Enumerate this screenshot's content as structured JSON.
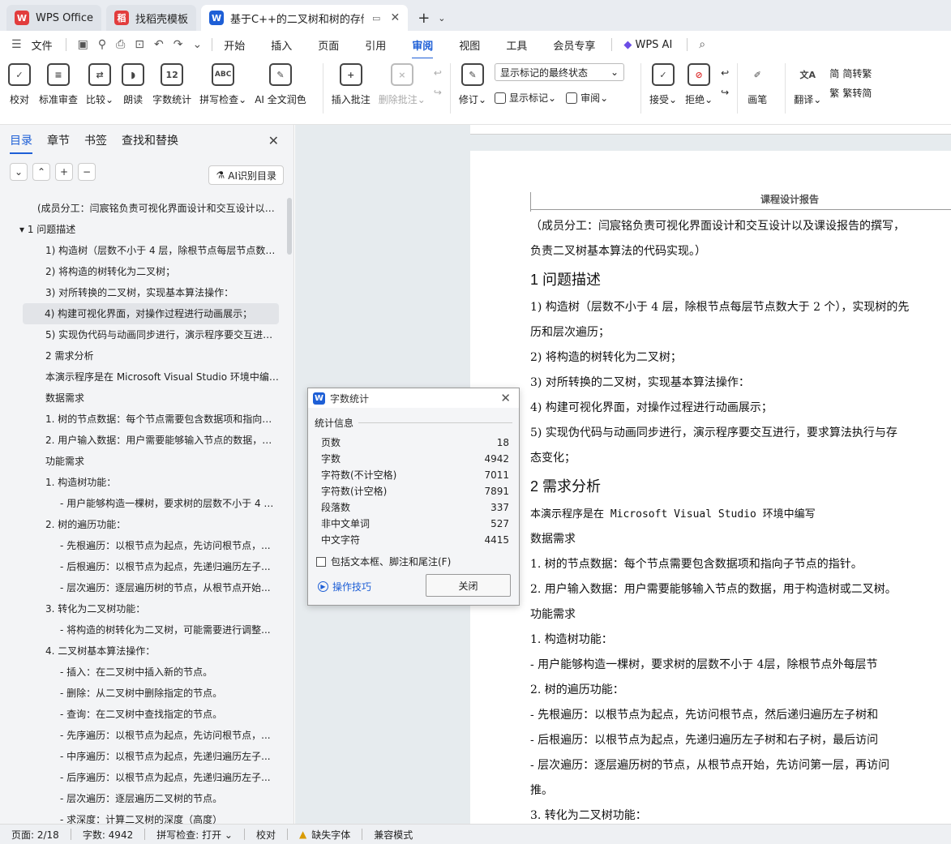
{
  "tabs": [
    {
      "label": "WPS Office",
      "icon": "W",
      "color": "#e23d3d"
    },
    {
      "label": "找稻壳模板",
      "icon": "稻",
      "color": "#e23d3d"
    },
    {
      "label": "基于C++的二叉树和树的存储",
      "icon": "W",
      "color": "#1e5fd6"
    }
  ],
  "menu": {
    "file": "文件",
    "items": [
      "开始",
      "插入",
      "页面",
      "引用",
      "审阅",
      "视图",
      "工具",
      "会员专享"
    ],
    "active": "审阅",
    "wpsai": "WPS AI"
  },
  "ribbon": {
    "proof": "校对",
    "std_review": "标准审查",
    "compare": "比较",
    "read": "朗读",
    "wordcount": "字数统计",
    "spell": "拼写检查",
    "ai_polish": "AI 全文润色",
    "insert_comment": "插入批注",
    "delete_comment": "删除批注",
    "track": "修订",
    "show_markup_combo": "显示标记的最终状态",
    "show_markup": "显示标记",
    "review": "审阅",
    "accept": "接受",
    "reject": "拒绝",
    "pen": "画笔",
    "translate": "翻译",
    "to_trad": "简转繁",
    "to_simp": "繁转简"
  },
  "nav": {
    "tabs": [
      "目录",
      "章节",
      "书签",
      "查找和替换"
    ],
    "active_tab": "目录",
    "ai_button": "AI识别目录",
    "items": [
      {
        "text": "(成员分工：闫宸铭负责可视化界面设计和交互设计以及课设报告的撰写...",
        "indent": 46
      },
      {
        "text": "▾  1  问题描述",
        "indent": 24
      },
      {
        "text": "1) 构造树（层数不小于 4 层，除根节点每层节点数大于 2 个）...",
        "indent": 56
      },
      {
        "text": "2) 将构造的树转化为二叉树；",
        "indent": 56
      },
      {
        "text": "3) 对所转换的二叉树，实现基本算法操作：",
        "indent": 56
      },
      {
        "text": "4) 构建可视化界面，对操作过程进行动画展示；",
        "indent": 56,
        "selected": true
      },
      {
        "text": "5) 实现伪代码与动画同步进行，演示程序要交互进行...",
        "indent": 56
      },
      {
        "text": "2  需求分析",
        "indent": 56
      },
      {
        "text": "本演示程序是在 Microsoft Visual Studio 环境中编写...",
        "indent": 56
      },
      {
        "text": "数据需求",
        "indent": 56
      },
      {
        "text": "1. 树的节点数据：每个节点需要包含数据项和指向子节点的指针...",
        "indent": 56
      },
      {
        "text": "2. 用户输入数据：用户需要能够输入节点的数据，用于构造树...",
        "indent": 56
      },
      {
        "text": "功能需求",
        "indent": 56
      },
      {
        "text": "1. 构造树功能：",
        "indent": 56
      },
      {
        "text": "- 用户能够构造一棵树，要求树的层数不小于 4 层...",
        "indent": 74
      },
      {
        "text": "2. 树的遍历功能：",
        "indent": 56
      },
      {
        "text": "- 先根遍历：以根节点为起点，先访问根节点，...",
        "indent": 74
      },
      {
        "text": "- 后根遍历：以根节点为起点，先递归遍历左子...",
        "indent": 74
      },
      {
        "text": "- 层次遍历：逐层遍历树的节点，从根节点开始...",
        "indent": 74
      },
      {
        "text": "3. 转化为二叉树功能：",
        "indent": 56
      },
      {
        "text": "- 将构造的树转化为二叉树，可能需要进行调整...",
        "indent": 74
      },
      {
        "text": "4. 二叉树基本算法操作：",
        "indent": 56
      },
      {
        "text": "- 插入：在二叉树中插入新的节点。",
        "indent": 74
      },
      {
        "text": "- 删除：从二叉树中删除指定的节点。",
        "indent": 74
      },
      {
        "text": "- 查询：在二叉树中查找指定的节点。",
        "indent": 74
      },
      {
        "text": "- 先序遍历：以根节点为起点，先访问根节点，...",
        "indent": 74
      },
      {
        "text": "- 中序遍历：以根节点为起点，先递归遍历左子...",
        "indent": 74
      },
      {
        "text": "- 后序遍历：以根节点为起点，先递归遍历左子...",
        "indent": 74
      },
      {
        "text": "- 层次遍历：逐层遍历二叉树的节点。",
        "indent": 74
      },
      {
        "text": "- 求深度：计算二叉树的深度（高度）",
        "indent": 74
      }
    ]
  },
  "doc": {
    "header": "课程设计报告",
    "lines": [
      {
        "t": "（成员分工：闫宸铭负责可视化界面设计和交互设计以及课设报告的撰写，",
        "c": "p"
      },
      {
        "t": "负责二叉树基本算法的代码实现。）",
        "c": "p"
      },
      {
        "t": "1  问题描述",
        "c": "h"
      },
      {
        "t": "1)  构造树（层数不小于 4 层，除根节点每层节点数大于 2 个），实现树的先",
        "c": "p"
      },
      {
        "t": "历和层次遍历；",
        "c": "p"
      },
      {
        "t": "2)  将构造的树转化为二叉树；",
        "c": "p"
      },
      {
        "t": "3)  对所转换的二叉树，实现基本算法操作：",
        "c": "p"
      },
      {
        "t": "4)  构建可视化界面，对操作过程进行动画展示；",
        "c": "p"
      },
      {
        "t": "5)  实现伪代码与动画同步进行，演示程序要交互进行，要求算法执行与存",
        "c": "p"
      },
      {
        "t": "态变化；",
        "c": "p"
      },
      {
        "t": "2 需求分析",
        "c": "h"
      },
      {
        "t": "本演示程序是在 Microsoft Visual Studio 环境中编写",
        "c": "p"
      },
      {
        "t": "数据需求",
        "c": "p"
      },
      {
        "t": "1. 树的节点数据：每个节点需要包含数据项和指向子节点的指针。",
        "c": "p"
      },
      {
        "t": "2. 用户输入数据：用户需要能够输入节点的数据，用于构造树或二叉树。",
        "c": "p"
      },
      {
        "t": "功能需求",
        "c": "p"
      },
      {
        "t": "1. 构造树功能：",
        "c": "p"
      },
      {
        "t": "    - 用户能够构造一棵树，要求树的层数不小于 4层，除根节点外每层节",
        "c": "p"
      },
      {
        "t": "2. 树的遍历功能：",
        "c": "p"
      },
      {
        "t": "    - 先根遍历：以根节点为起点，先访问根节点，然后递归遍历左子树和",
        "c": "p"
      },
      {
        "t": "    - 后根遍历：以根节点为起点，先递归遍历左子树和右子树，最后访问",
        "c": "p"
      },
      {
        "t": "    - 层次遍历：逐层遍历树的节点，从根节点开始，先访问第一层，再访问",
        "c": "p"
      },
      {
        "t": "推。",
        "c": "p"
      },
      {
        "t": "3. 转化为二叉树功能：",
        "c": "p"
      }
    ]
  },
  "dialog": {
    "title": "字数统计",
    "section": "统计信息",
    "stats": [
      {
        "label": "页数",
        "value": "18"
      },
      {
        "label": "字数",
        "value": "4942"
      },
      {
        "label": "字符数(不计空格)",
        "value": "7011"
      },
      {
        "label": "字符数(计空格)",
        "value": "7891"
      },
      {
        "label": "段落数",
        "value": "337"
      },
      {
        "label": "非中文单词",
        "value": "527"
      },
      {
        "label": "中文字符",
        "value": "4415"
      }
    ],
    "checkbox": "包括文本框、脚注和尾注(F)",
    "tips": "操作技巧",
    "close_button": "关闭"
  },
  "status": {
    "page": "页面: 2/18",
    "words": "字数: 4942",
    "spell": "拼写检查: 打开",
    "proof": "校对",
    "missing_font": "缺失字体",
    "compat": "兼容模式"
  }
}
